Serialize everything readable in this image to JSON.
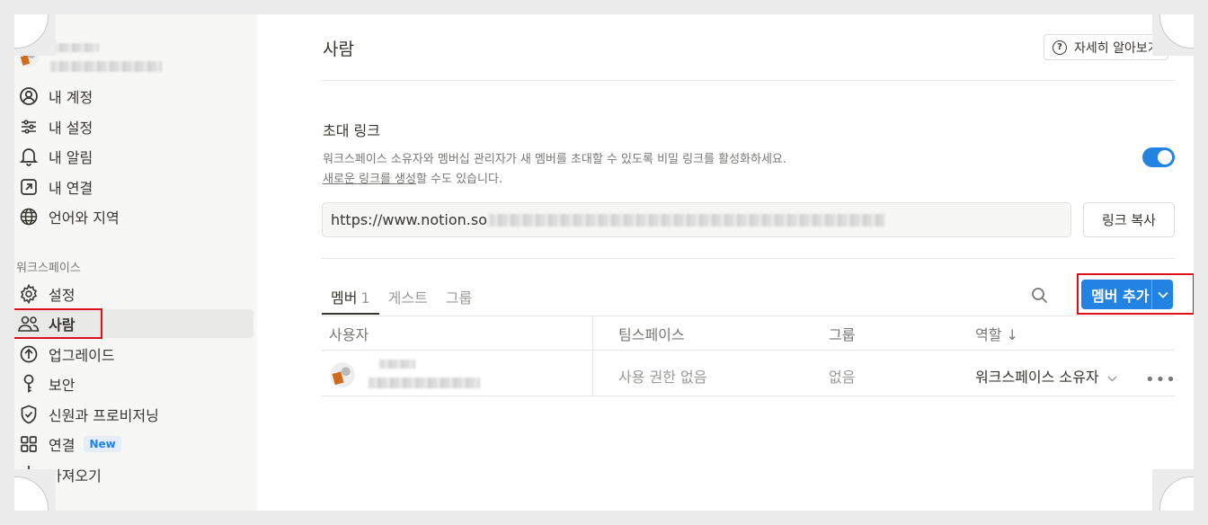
{
  "sidebar": {
    "top_label": "정",
    "account_items": [
      {
        "label": "내 계정",
        "icon": "account-circle-icon"
      },
      {
        "label": "내 설정",
        "icon": "sliders-icon"
      },
      {
        "label": "내 알림",
        "icon": "bell-icon"
      },
      {
        "label": "내 연결",
        "icon": "arrow-box-icon"
      },
      {
        "label": "언어와 지역",
        "icon": "globe-icon"
      }
    ],
    "workspace_section": "워크스페이스",
    "workspace_items": [
      {
        "label": "설정",
        "icon": "gear-icon"
      },
      {
        "label": "사람",
        "icon": "people-icon"
      },
      {
        "label": "업그레이드",
        "icon": "arrow-up-circle-icon"
      },
      {
        "label": "보안",
        "icon": "key-icon"
      },
      {
        "label": "신원과 프로비저닝",
        "icon": "shield-icon"
      },
      {
        "label": "연결",
        "icon": "grid-icon",
        "badge": "New"
      },
      {
        "label": "가져오기",
        "icon": "download-arrow-icon"
      }
    ]
  },
  "main": {
    "title": "사람",
    "learn_more": "자세히 알아보기",
    "invite": {
      "title": "초대 링크",
      "description": "워크스페이스 소유자와 멤버십 관리자가 새 멤버를 초대할 수 있도록 비밀 링크를 활성화하세요.",
      "generate_link": "새로운 링크를 생성",
      "generate_suffix": "할 수도 있습니다.",
      "enabled": true,
      "url": "https://www.notion.so",
      "copy_label": "링크 복사"
    },
    "tabs": [
      {
        "label": "멤버",
        "count": "1"
      },
      {
        "label": "게스트"
      },
      {
        "label": "그룹"
      }
    ],
    "add_member": "멤버 추가",
    "table": {
      "headers": [
        "사용자",
        "팀스페이스",
        "그룹",
        "역할 ↓"
      ],
      "rows": [
        {
          "teamspace": "사용 권한 없음",
          "group": "없음",
          "role": "워크스페이스 소유자"
        }
      ]
    }
  },
  "colors": {
    "accent": "#2383e2",
    "highlight": "#e0101a"
  }
}
